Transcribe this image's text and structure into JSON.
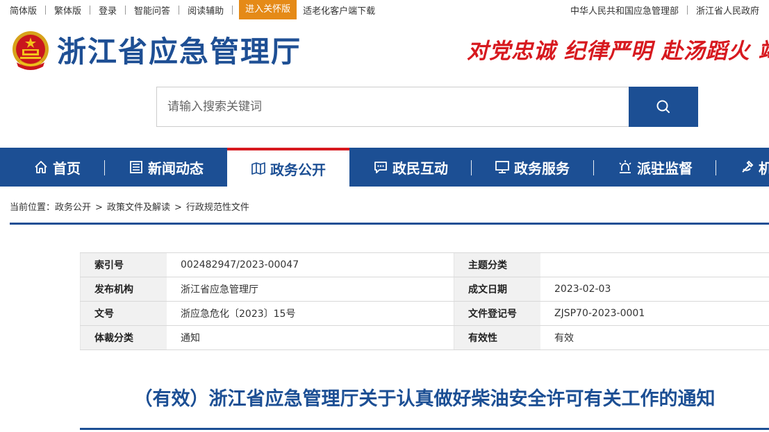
{
  "topbar": {
    "left_links": [
      "简体版",
      "繁体版",
      "登录",
      "智能问答",
      "阅读辅助"
    ],
    "care_mode": "进入关怀版",
    "elder_app": "适老化客户端下载",
    "right_links": [
      "中华人民共和国应急管理部",
      "浙江省人民政府"
    ]
  },
  "header": {
    "site_title": "浙江省应急管理厅",
    "slogan": "对党忠诚 纪律严明 赴汤蹈火 竭"
  },
  "search": {
    "placeholder": "请输入搜索关键词"
  },
  "nav": {
    "items": [
      "首页",
      "新闻动态",
      "政务公开",
      "政民互动",
      "政务服务",
      "派驻监督",
      "机"
    ],
    "active": "政务公开"
  },
  "breadcrumb": {
    "prefix": "当前位置：",
    "items": [
      "政务公开",
      "政策文件及解读",
      "行政规范性文件"
    ],
    "separator": ">"
  },
  "info": {
    "rows": [
      {
        "k1": "索引号",
        "v1": "002482947/2023-00047",
        "k2": "主题分类",
        "v2": ""
      },
      {
        "k1": "发布机构",
        "v1": "浙江省应急管理厅",
        "k2": "成文日期",
        "v2": "2023-02-03"
      },
      {
        "k1": "文号",
        "v1": "浙应急危化〔2023〕15号",
        "k2": "文件登记号",
        "v2": "ZJSP70-2023-0001"
      },
      {
        "k1": "体裁分类",
        "v1": "通知",
        "k2": "有效性",
        "v2": "有效"
      }
    ]
  },
  "document": {
    "title": "（有效）浙江省应急管理厅关于认真做好柴油安全许可有关工作的通知"
  },
  "colors": {
    "primary": "#1c4f94",
    "accent_red": "#d7191f",
    "care_orange": "#e58a17"
  }
}
